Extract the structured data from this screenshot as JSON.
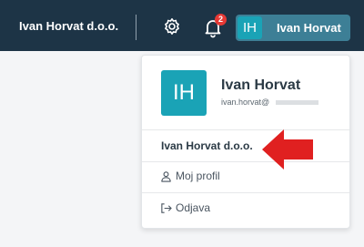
{
  "topbar": {
    "company_name": "Ivan Horvat d.o.o.",
    "notifications_count": "2",
    "user_initials": "IH",
    "user_name": "Ivan Horvat",
    "background_color": "#1d3446",
    "user_button_color": "#3d7f96",
    "icons": [
      "gear-icon",
      "bell-icon"
    ]
  },
  "dropdown": {
    "avatar_initials": "IH",
    "avatar_color": "#1aa3b6",
    "full_name": "Ivan Horvat",
    "email_visible": "ivan.horvat@",
    "company_item": "Ivan Horvat d.o.o.",
    "menu_items": [
      {
        "label": "Moj profil",
        "icon": "user-icon"
      },
      {
        "label": "Odjava",
        "icon": "logout-icon"
      }
    ]
  },
  "annotation": {
    "arrow_color": "#e02020",
    "arrow_icon": "arrow-left-icon"
  }
}
